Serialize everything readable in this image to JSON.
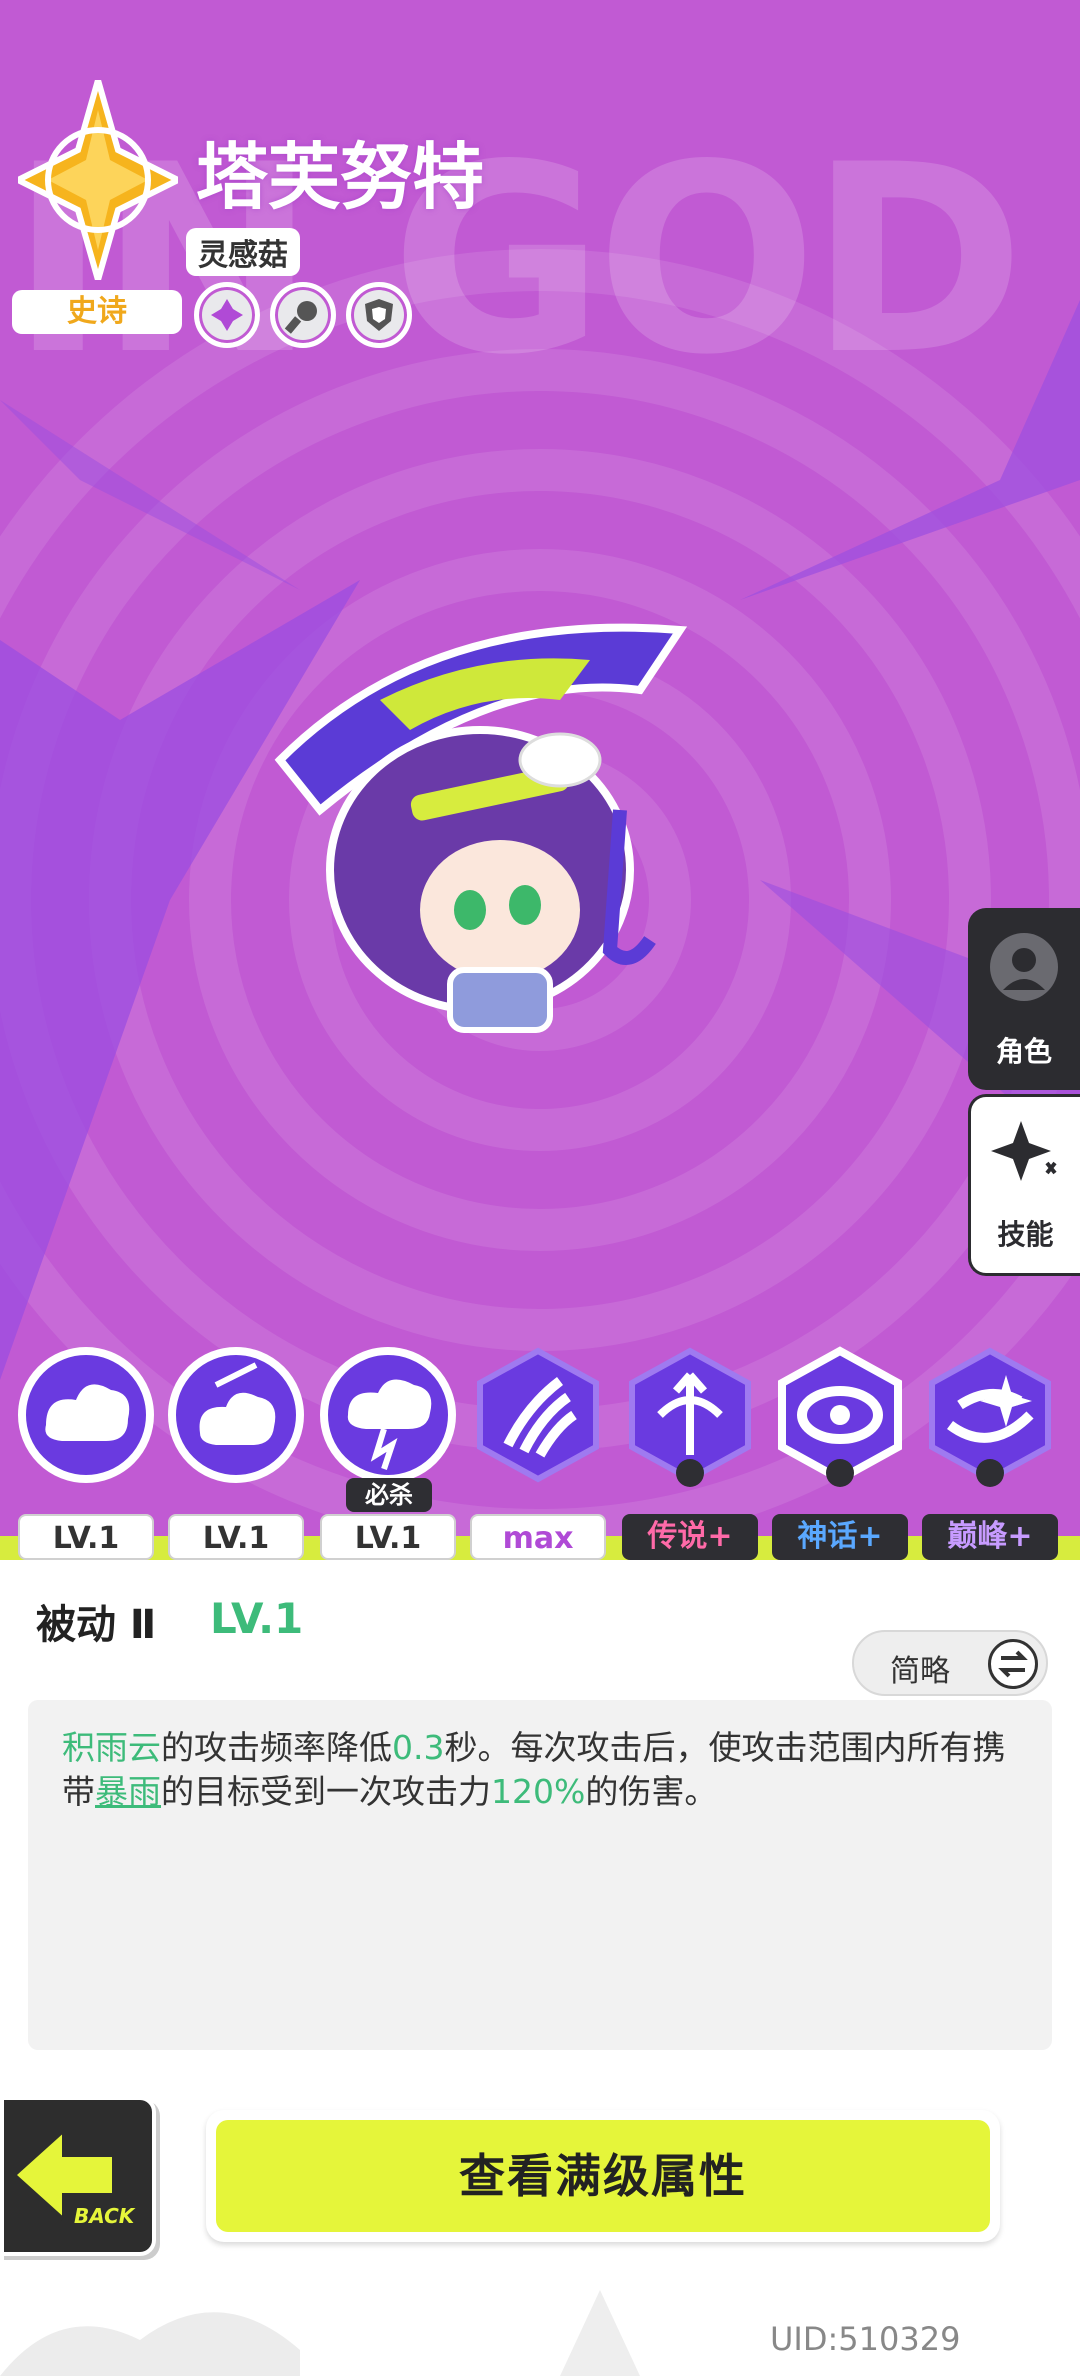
{
  "header": {
    "background_text": "IN GOD",
    "name": "塔芙努特",
    "subtitle": "灵感菇",
    "rarity": "史诗"
  },
  "traits": [
    "cross-icon",
    "wrench-icon",
    "shield-icon"
  ],
  "side_tabs": [
    {
      "label": "角色",
      "icon": "person-icon"
    },
    {
      "label": "技能",
      "icon": "sparkle-icon"
    }
  ],
  "skills": [
    {
      "icon": "cloud-face-icon",
      "level": "LV.1",
      "locked": false
    },
    {
      "icon": "cloud-angry-icon",
      "level": "LV.1",
      "locked": false
    },
    {
      "icon": "storm-cloud-icon",
      "level": "LV.1",
      "locked": false,
      "tag": "必杀"
    },
    {
      "icon": "claw-icon",
      "level": "max",
      "locked": false
    },
    {
      "icon": "fountain-icon",
      "level": "传说+",
      "locked": true
    },
    {
      "icon": "vortex-icon",
      "level": "神话+",
      "locked": true
    },
    {
      "icon": "whirlwind-icon",
      "level": "巅峰+",
      "locked": true
    }
  ],
  "detail": {
    "title": "被动 Ⅱ",
    "level": "LV.1",
    "toggle_label": "简略",
    "desc": {
      "t1": "积雨云",
      "t2": "的攻击频率降低",
      "t3": "0.3",
      "t4": "秒。每次攻击后，使攻击范围内所有携带",
      "t5": "暴雨",
      "t6": "的目标受到一次攻击力",
      "t7": "120%",
      "t8": "的伤害。"
    }
  },
  "footer": {
    "back_label": "BACK",
    "max_button": "查看满级属性",
    "uid": "UID:510329"
  },
  "colors": {
    "bg": "#c15ad3",
    "accent_green": "#3dbb7a",
    "button_yellow": "#e5f53a",
    "rarity_gold": "#f0a81c"
  }
}
